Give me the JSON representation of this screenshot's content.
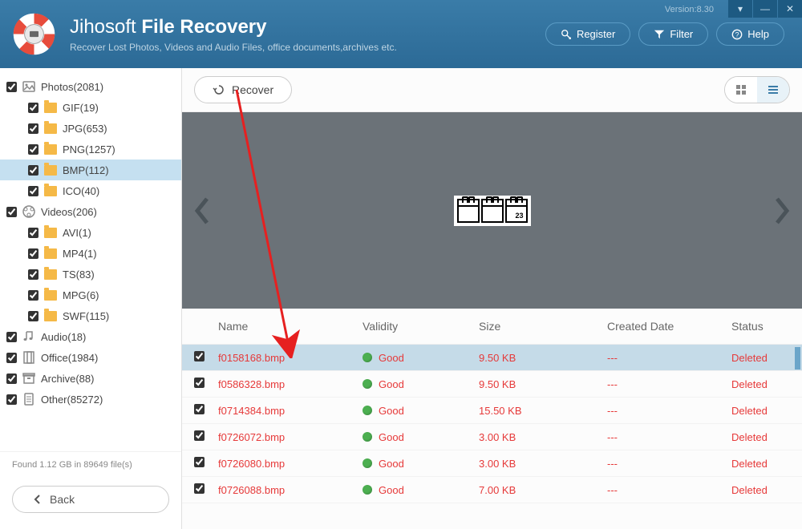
{
  "header": {
    "title_light": "Jihosoft",
    "title_bold": "File Recovery",
    "subtitle": "Recover Lost Photos, Videos and Audio Files, office documents,archives etc.",
    "version": "Version:8.30",
    "buttons": {
      "register": "Register",
      "filter": "Filter",
      "help": "Help"
    }
  },
  "sidebar": {
    "categories": [
      {
        "label": "Photos(2081)",
        "icon": "photo",
        "children": [
          {
            "label": "GIF(19)",
            "checked": true
          },
          {
            "label": "JPG(653)",
            "checked": true
          },
          {
            "label": "PNG(1257)",
            "checked": true
          },
          {
            "label": "BMP(112)",
            "checked": true,
            "selected": true
          },
          {
            "label": "ICO(40)",
            "checked": true
          }
        ]
      },
      {
        "label": "Videos(206)",
        "icon": "video",
        "children": [
          {
            "label": "AVI(1)",
            "checked": true
          },
          {
            "label": "MP4(1)",
            "checked": true
          },
          {
            "label": "TS(83)",
            "checked": true
          },
          {
            "label": "MPG(6)",
            "checked": true
          },
          {
            "label": "SWF(115)",
            "checked": true
          }
        ]
      },
      {
        "label": "Audio(18)",
        "icon": "audio",
        "children": []
      },
      {
        "label": "Office(1984)",
        "icon": "office",
        "children": []
      },
      {
        "label": "Archive(88)",
        "icon": "archive",
        "children": []
      },
      {
        "label": "Other(85272)",
        "icon": "other",
        "children": []
      }
    ],
    "footer": "Found 1.12 GB in 89649 file(s)",
    "back": "Back"
  },
  "toolbar": {
    "recover": "Recover"
  },
  "preview": {
    "day": "23"
  },
  "table": {
    "headers": {
      "name": "Name",
      "validity": "Validity",
      "size": "Size",
      "created": "Created Date",
      "status": "Status"
    },
    "rows": [
      {
        "name": "f0158168.bmp",
        "validity": "Good",
        "size": "9.50 KB",
        "created": "---",
        "status": "Deleted",
        "selected": true
      },
      {
        "name": "f0586328.bmp",
        "validity": "Good",
        "size": "9.50 KB",
        "created": "---",
        "status": "Deleted"
      },
      {
        "name": "f0714384.bmp",
        "validity": "Good",
        "size": "15.50 KB",
        "created": "---",
        "status": "Deleted"
      },
      {
        "name": "f0726072.bmp",
        "validity": "Good",
        "size": "3.00 KB",
        "created": "---",
        "status": "Deleted"
      },
      {
        "name": "f0726080.bmp",
        "validity": "Good",
        "size": "3.00 KB",
        "created": "---",
        "status": "Deleted"
      },
      {
        "name": "f0726088.bmp",
        "validity": "Good",
        "size": "7.00 KB",
        "created": "---",
        "status": "Deleted"
      }
    ]
  }
}
